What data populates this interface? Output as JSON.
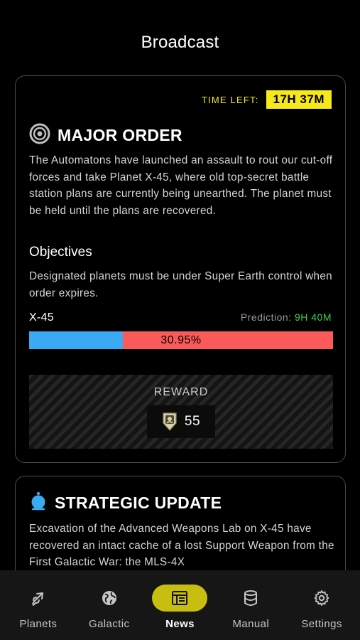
{
  "header": {
    "title": "Broadcast"
  },
  "major_order": {
    "time_left_label": "TIME LEFT:",
    "time_left_value": "17H 37M",
    "icon": "target-rings-icon",
    "title": "MAJOR ORDER",
    "description": "The Automatons have launched an assault to rout our cut-off forces and take Planet X-45, where old top-secret battle station plans are currently being unearthed. The planet must be held until the plans are recovered.",
    "objectives_heading": "Objectives",
    "objectives_description": "Designated planets must be under Super Earth control when order expires.",
    "planet": {
      "name": "X-45",
      "prediction_label": "Prediction:",
      "prediction_value": "9H 40M",
      "progress_percent": 30.95,
      "progress_label": "30.95%"
    },
    "reward": {
      "label": "REWARD",
      "icon": "medal-icon",
      "amount": "55"
    }
  },
  "strategic_update": {
    "icon": "beacon-icon",
    "title": "STRATEGIC UPDATE",
    "description": "Excavation of the Advanced Weapons Lab on X-45 have recovered an intact cache of a lost Support Weapon from the First Galactic War: the MLS-4X"
  },
  "tabbar": {
    "tabs": [
      {
        "label": "Planets",
        "icon": "rocket-icon",
        "active": false
      },
      {
        "label": "Galactic",
        "icon": "globe-icon",
        "active": false
      },
      {
        "label": "News",
        "icon": "newspaper-icon",
        "active": true
      },
      {
        "label": "Manual",
        "icon": "database-icon",
        "active": false
      },
      {
        "label": "Settings",
        "icon": "gear-icon",
        "active": false
      }
    ]
  },
  "colors": {
    "accent_yellow": "#f5e81b",
    "active_tab": "#c8be10",
    "progress_blue": "#3aaaf3",
    "progress_red": "#fb5a5a",
    "prediction_green": "#3fd14f"
  }
}
